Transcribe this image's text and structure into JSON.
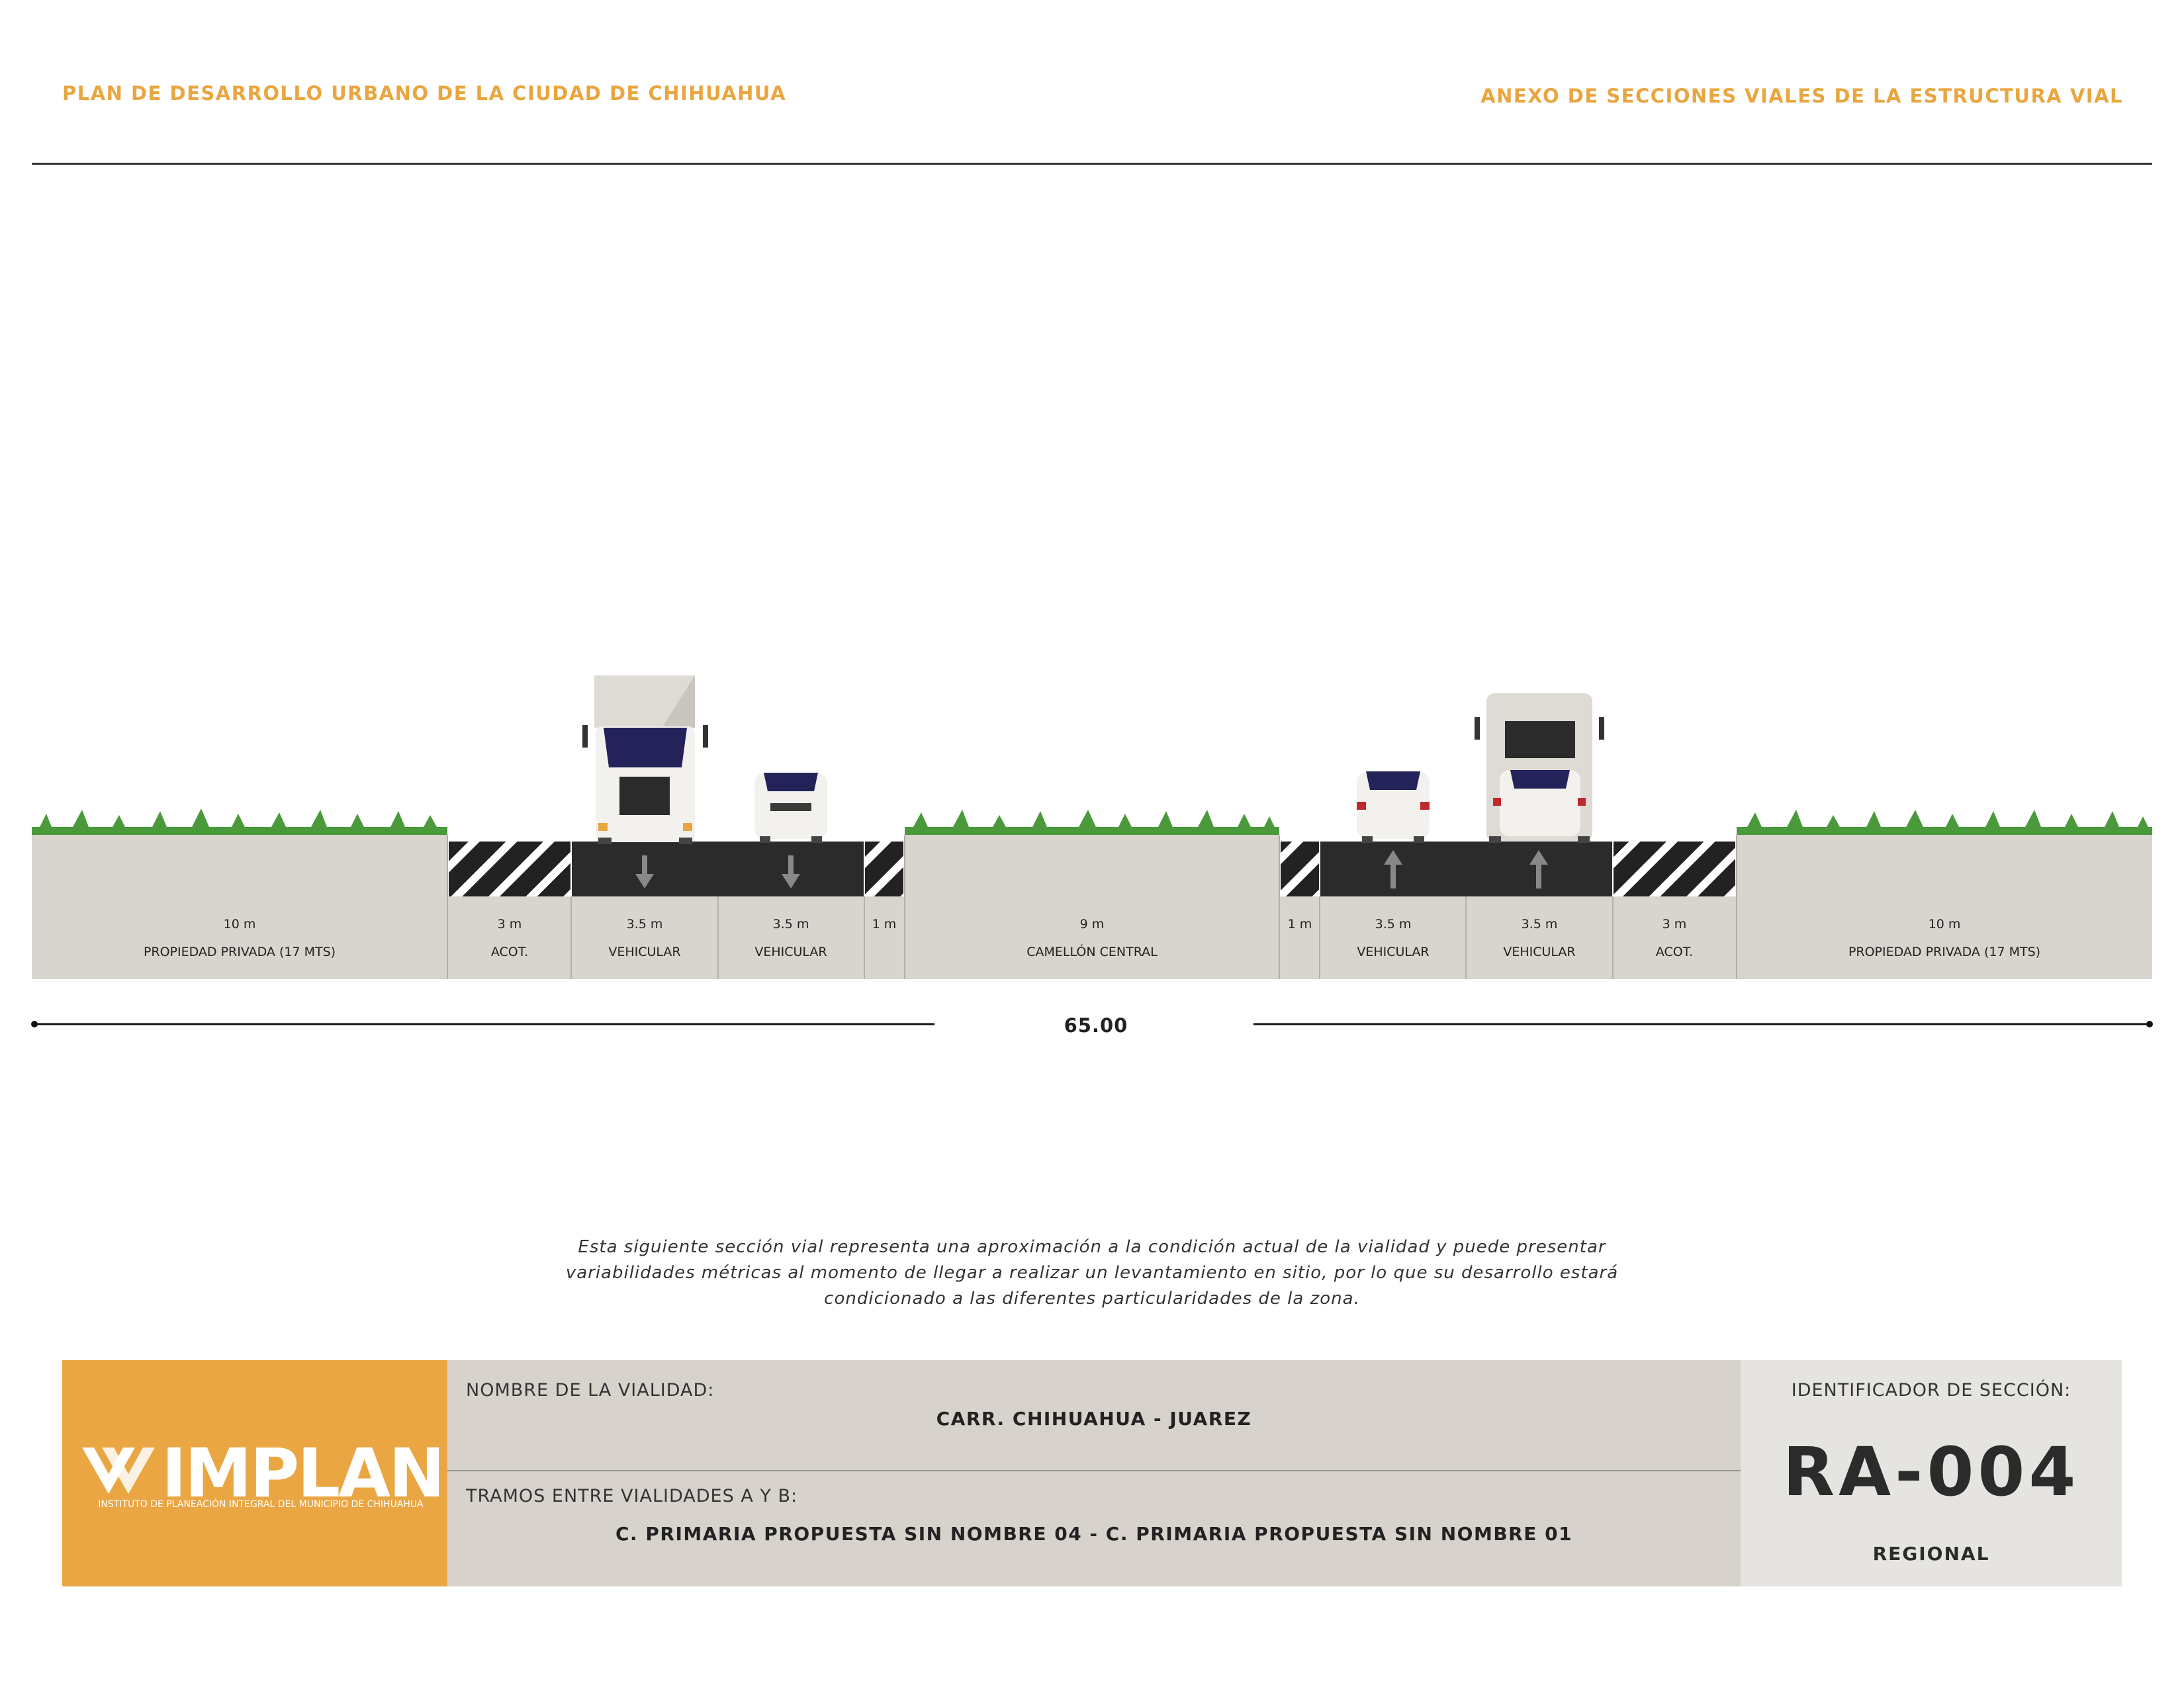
{
  "header": {
    "left": "PLAN DE DESARROLLO URBANO DE LA CIUDAD DE CHIHUAHUA",
    "right": "ANEXO DE SECCIONES VIALES DE LA ESTRUCTURA VIAL"
  },
  "section": {
    "segments": [
      {
        "size": "10 m",
        "name": "PROPIEDAD PRIVADA (17 MTS)",
        "type": "property"
      },
      {
        "size": "3 m",
        "name": "ACOT.",
        "type": "shoulder"
      },
      {
        "size": "3.5 m",
        "name": "VEHICULAR",
        "type": "lane",
        "direction": "down"
      },
      {
        "size": "3.5 m",
        "name": "VEHICULAR",
        "type": "lane",
        "direction": "down"
      },
      {
        "size": "1 m",
        "name": "",
        "type": "shoulder"
      },
      {
        "size": "9 m",
        "name": "CAMELLÓN CENTRAL",
        "type": "median"
      },
      {
        "size": "1 m",
        "name": "",
        "type": "shoulder"
      },
      {
        "size": "3.5 m",
        "name": "VEHICULAR",
        "type": "lane",
        "direction": "up"
      },
      {
        "size": "3.5 m",
        "name": "VEHICULAR",
        "type": "lane",
        "direction": "up"
      },
      {
        "size": "3 m",
        "name": "ACOT.",
        "type": "shoulder"
      },
      {
        "size": "10 m",
        "name": "PROPIEDAD PRIVADA (17 MTS)",
        "type": "property"
      }
    ],
    "total_width": "65.00",
    "colors": {
      "ground": "#d8d4ce",
      "asphalt": "#2b2b2b",
      "grass": "#4a9a3c"
    }
  },
  "note": "Esta siguiente sección vial representa una aproximación a la condición actual de la vialidad y puede presentar variabilidades métricas al momento de llegar a realizar un levantamiento en sitio, por lo que su desarrollo estará condicionado a las diferentes particularidades de la zona.",
  "title_block": {
    "logo_text": "IMPLAN",
    "logo_sub": "INSTITUTO DE PLANEACIÓN INTEGRAL DEL MUNICIPIO DE CHIHUAHUA",
    "road_name_label": "NOMBRE DE LA VIALIDAD:",
    "road_name": "CARR. CHIHUAHUA - JUAREZ",
    "segment_label": "TRAMOS ENTRE VIALIDADES A Y B:",
    "segment_value": "C. PRIMARIA PROPUESTA SIN NOMBRE 04 - C. PRIMARIA PROPUESTA SIN NOMBRE 01",
    "id_label": "IDENTIFICADOR DE SECCIÓN:",
    "id_code": "RA-004",
    "classification": "REGIONAL",
    "brand_color": "#eaa642"
  }
}
